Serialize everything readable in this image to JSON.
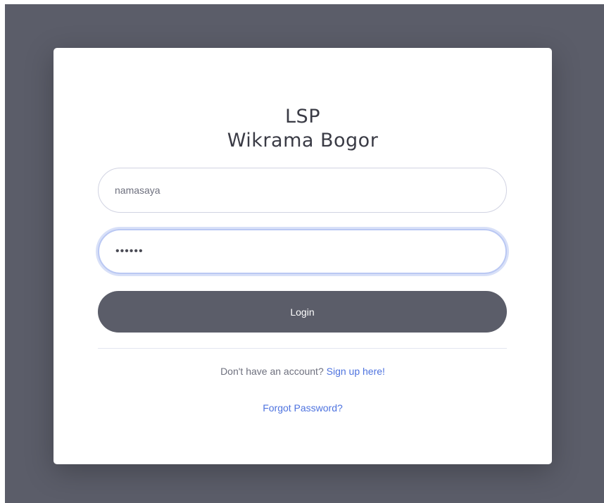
{
  "header": {
    "title_line1": "LSP",
    "title_line2": "Wikrama Bogor"
  },
  "form": {
    "username_value": "namasaya",
    "password_value": "••••••",
    "login_label": "Login"
  },
  "footer": {
    "no_account_text": "Don't have an account?",
    "signup_link": "Sign up here!",
    "forgot_link": "Forgot Password?"
  },
  "colors": {
    "background": "#5b5d69",
    "card": "#ffffff",
    "button": "#5b5d69",
    "link": "#4e73df",
    "focus_ring": "#bac8f3"
  }
}
